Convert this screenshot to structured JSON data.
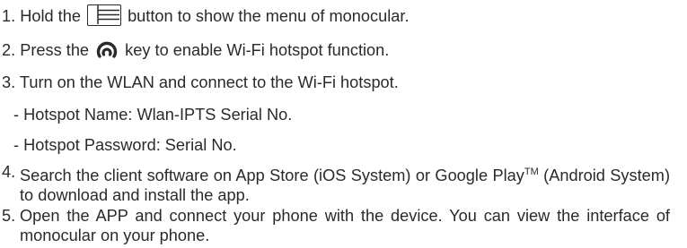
{
  "steps": {
    "step1": {
      "before_icon": "1. Hold the ",
      "icon": "menu-list-icon",
      "after_icon": " button to show the menu of monocular."
    },
    "step2": {
      "before_icon": "2. Press the ",
      "icon": "hotspot-icon",
      "after_icon": " key to enable Wi-Fi hotspot function."
    },
    "step3": {
      "text": "3. Turn on the WLAN and connect to the Wi-Fi hotspot.",
      "sub_items": [
        "- Hotspot Name: Wlan-IPTS Serial No.",
        "- Hotspot Password: Serial No."
      ]
    },
    "step4": {
      "number": "4.",
      "text_main": "Search the client software on App Store (iOS System) or Google Play",
      "trademark": "TM",
      "text_rest": "(Android System) to download and install the app."
    },
    "step5": {
      "number": "5.",
      "text": "Open the APP and connect your phone with the device. You can view the interface of monocular on your phone."
    }
  },
  "colors": {
    "text": "#2a2a2a",
    "background": "#ffffff"
  }
}
